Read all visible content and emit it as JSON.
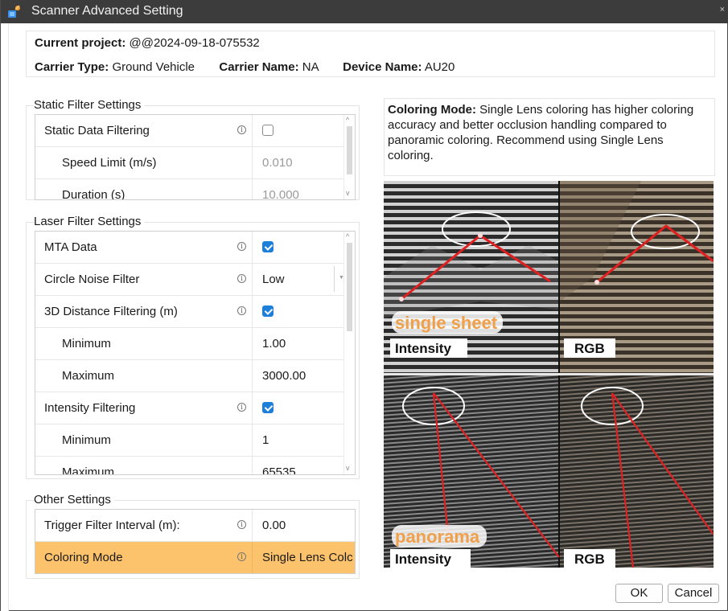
{
  "window": {
    "title": "Scanner Advanced Setting",
    "close_glyph": "×"
  },
  "project": {
    "current_project_label": "Current project:",
    "current_project_value": "@@2024-09-18-075532",
    "carrier_type_label": "Carrier Type:",
    "carrier_type_value": "Ground Vehicle",
    "carrier_name_label": "Carrier Name:",
    "carrier_name_value": "NA",
    "device_name_label": "Device Name:",
    "device_name_value": "AU20"
  },
  "static_filter": {
    "title": "Static Filter Settings",
    "rows": [
      {
        "name": "Static Data Filtering",
        "type": "checkbox",
        "checked": false
      },
      {
        "name": "Speed Limit (m/s)",
        "value": "0.010"
      },
      {
        "name": "Duration (s)",
        "value": "10.000"
      }
    ]
  },
  "laser_filter": {
    "title": "Laser Filter Settings",
    "rows": [
      {
        "name": "MTA Data",
        "type": "checkbox",
        "checked": true
      },
      {
        "name": "Circle Noise Filter",
        "value": "Low",
        "dropdown_arrow": "▼"
      },
      {
        "name": "3D Distance Filtering (m)",
        "type": "checkbox",
        "checked": true
      },
      {
        "name": "Minimum",
        "value": "1.00"
      },
      {
        "name": "Maximum",
        "value": "3000.00"
      },
      {
        "name": "Intensity Filtering",
        "type": "checkbox",
        "checked": true
      },
      {
        "name": "Minimum",
        "value": "1"
      },
      {
        "name": "Maximum",
        "value": "65535"
      }
    ]
  },
  "other_settings": {
    "title": "Other Settings",
    "rows": [
      {
        "name": "Trigger Filter Interval (m):",
        "value": "0.00"
      },
      {
        "name": "Coloring Mode",
        "value": "Single Lens Colc"
      }
    ]
  },
  "coloring_description": {
    "label": "Coloring Mode:",
    "text": "Single Lens coloring has higher coloring accuracy and better occlusion handling compared to panoramic coloring. Recommend using Single Lens coloring."
  },
  "demo_image": {
    "top_caption": "single sheet",
    "bottom_caption": "panorama",
    "top_left_label": "Intensity",
    "top_right_label": "RGB",
    "bottom_left_label": "Intensity",
    "bottom_right_label": "RGB"
  },
  "info_glyph": "i",
  "scroll_glyphs": {
    "up": "^",
    "down": "v"
  },
  "buttons": {
    "ok": "OK",
    "cancel": "Cancel"
  },
  "colors": {
    "selected_row": "#fcc26c",
    "checkbox_on": "#1e7fd8",
    "caption_orange": "#f0a04a",
    "annotation_red": "#e02020"
  }
}
